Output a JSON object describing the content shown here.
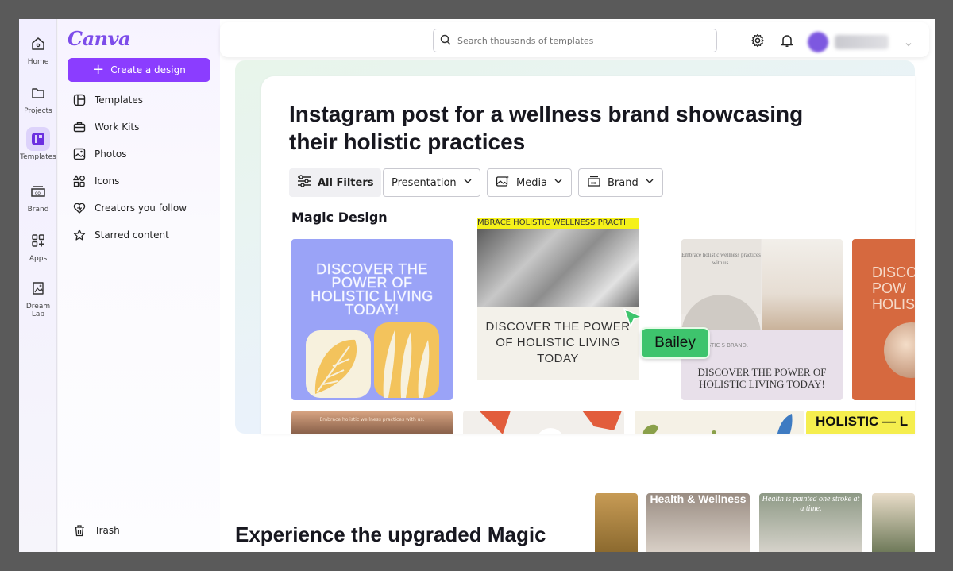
{
  "rail": {
    "items": [
      {
        "label": "Home",
        "icon": "home-icon"
      },
      {
        "label": "Projects",
        "icon": "folder-icon"
      },
      {
        "label": "Templates",
        "icon": "templates-icon",
        "active": true
      },
      {
        "label": "Brand",
        "icon": "brand-icon"
      },
      {
        "label": "Apps",
        "icon": "apps-icon"
      },
      {
        "label": "Dream Lab",
        "icon": "dream-lab-icon"
      }
    ]
  },
  "sidebar": {
    "logo": "Canva",
    "create_label": "Create a design",
    "items": [
      {
        "label": "Templates",
        "icon": "templates-icon"
      },
      {
        "label": "Work Kits",
        "icon": "briefcase-icon"
      },
      {
        "label": "Photos",
        "icon": "photo-icon"
      },
      {
        "label": "Icons",
        "icon": "shapes-icon"
      },
      {
        "label": "Creators you follow",
        "icon": "heart-icon"
      },
      {
        "label": "Starred content",
        "icon": "star-icon"
      }
    ],
    "trash_label": "Trash"
  },
  "header": {
    "search_placeholder": "Search thousands of templates"
  },
  "main": {
    "prompt_line1": "Instagram post for a wellness brand showcasing",
    "prompt_line2": "their holistic practices",
    "filters": {
      "all": "All Filters",
      "presentation": "Presentation",
      "media": "Media",
      "brand": "Brand"
    },
    "section_label": "Magic Design",
    "thumbs": {
      "t1_text": "DISCOVER THE POWER OF HOLISTIC LIVING TODAY!",
      "t2_band": "MBRACE HOLISTIC WELLNESS PRACTI",
      "t2_text": "DISCOVER THE POWER OF HOLISTIC LIVING TODAY",
      "t3_small": "Embrace holistic wellness practices with us.",
      "t3_brand": "HOLISTIC S BRAND.",
      "t3_text": "DISCOVER THE POWER OF HOLISTIC LIVING TODAY!",
      "t4_text": "DISCO POW HOLIS",
      "r2a_text": "Embrace holistic wellness practices with us.",
      "r2d_text": "HOLISTIC — L"
    },
    "collaborator": "Bailey",
    "bottom_title": "Experience the upgraded Magic",
    "bottom_thumbs": {
      "bt2_text": "Health & Wellness",
      "bt3_text": "Health is painted one stroke at a time."
    }
  },
  "colors": {
    "accent": "#8b3dff",
    "collaborator": "#3ec46d",
    "logo": "#7d4dea"
  }
}
